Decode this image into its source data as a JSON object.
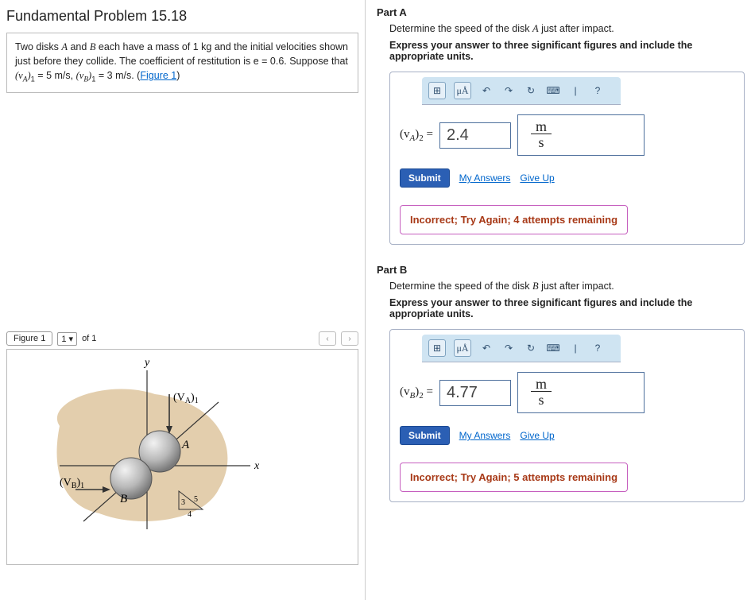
{
  "header": {
    "title": "Fundamental Problem 15.18"
  },
  "problem": {
    "text_prefix": "Two disks ",
    "A": "A",
    "and": " and ",
    "B": "B",
    "text_mid": " each have a mass of 1 kg and the initial velocities shown just before they collide. The coefficient of restitution is e = 0.6. Suppose that ",
    "vA_sym": "(v",
    "vA_sub": "A",
    "vA_close": ")",
    "one": "1",
    "equals_vA": " = 5  m/s",
    "comma": ", ",
    "vB_sym": "(v",
    "vB_sub": "B",
    "equals_vB": " = 3  m/s",
    "period_link": ". (",
    "figure_link": "Figure 1",
    "close_paren": ")"
  },
  "figure_nav": {
    "label_button": "Figure 1",
    "selector": "1",
    "of_text": " of 1",
    "prev": "‹",
    "next": "›"
  },
  "figure": {
    "y": "y",
    "x": "x",
    "A": "A",
    "B": "B",
    "vA": "(V",
    "vA_sub": "A",
    "vA_close": ")",
    "one": "1",
    "vB": "(V",
    "vB_sub": "B",
    "tri3": "3",
    "tri4": "4",
    "tri5": "5"
  },
  "partA": {
    "title": "Part A",
    "prompt_pre": "Determine the speed of the disk ",
    "A": "A",
    "prompt_post": " just after impact.",
    "instructions": "Express your answer to three significant figures and include the appropriate units.",
    "toolbar": {
      "templates": "⊞",
      "mu": "μÅ",
      "undo": "↶",
      "redo": "↷",
      "reset": "↻",
      "keyboard": "⌨",
      "sep": "|",
      "help": "?"
    },
    "lhs_open": "(v",
    "lhs_sub": "A",
    "lhs_close": ")",
    "lhs_two": "2",
    "lhs_eq": " = ",
    "value": "2.4",
    "unit_num": "m",
    "unit_den": "s",
    "submit": "Submit",
    "my_answers": "My Answers",
    "give_up": "Give Up",
    "feedback": "Incorrect; Try Again; 4 attempts remaining"
  },
  "partB": {
    "title": "Part B",
    "prompt_pre": "Determine the speed of the disk ",
    "B": "B",
    "prompt_post": " just after impact.",
    "instructions": "Express your answer to three significant figures and include the appropriate units.",
    "toolbar": {
      "templates": "⊞",
      "mu": "μÅ",
      "undo": "↶",
      "redo": "↷",
      "reset": "↻",
      "keyboard": "⌨",
      "sep": "|",
      "help": "?"
    },
    "lhs_open": "(v",
    "lhs_sub": "B",
    "lhs_close": ")",
    "lhs_two": "2",
    "lhs_eq": " = ",
    "value": "4.77",
    "unit_num": "m",
    "unit_den": "s",
    "submit": "Submit",
    "my_answers": "My Answers",
    "give_up": "Give Up",
    "feedback": "Incorrect; Try Again; 5 attempts remaining"
  }
}
